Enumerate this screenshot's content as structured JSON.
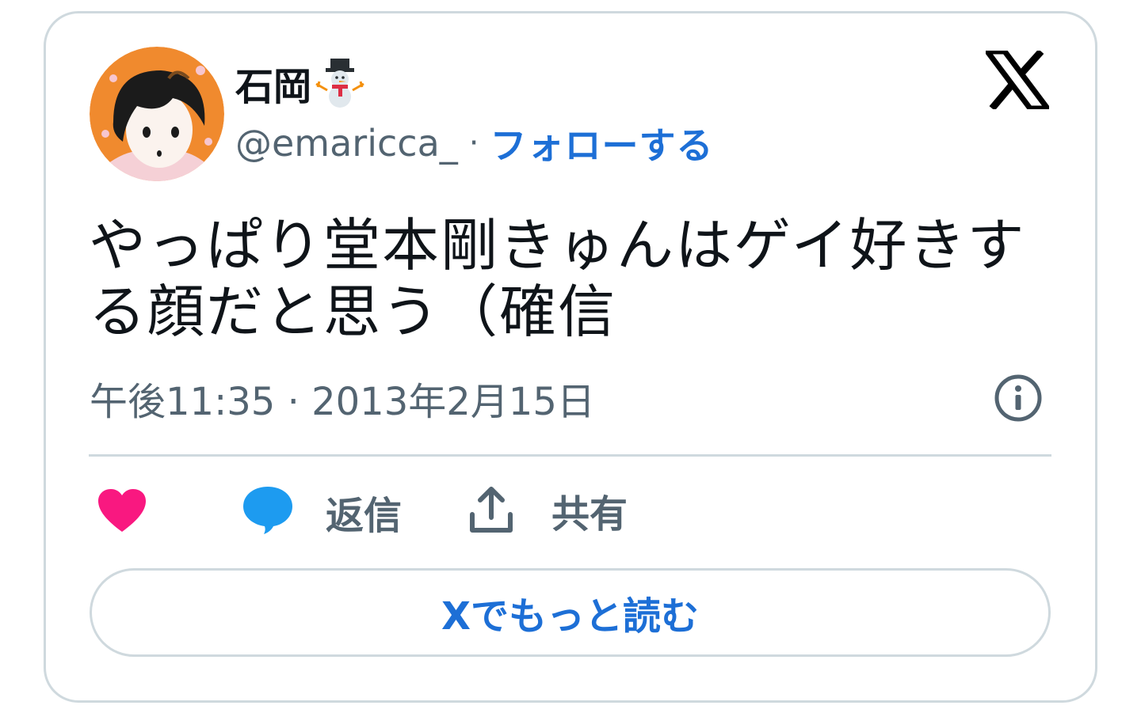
{
  "author": {
    "display_name": "石岡",
    "name_emoji_icon": "snowman-icon",
    "handle": "@emaricca_",
    "separator": "·",
    "follow_label": "フォローする"
  },
  "tweet": {
    "text": "やっぱり堂本剛きゅんはゲイ好きする顔だと思う（確信",
    "timestamp": "午後11:35 · 2013年2月15日"
  },
  "actions": {
    "like_icon": "heart-icon",
    "reply_icon": "speech-bubble-icon",
    "reply_label": "返信",
    "share_icon": "upload-icon",
    "share_label": "共有"
  },
  "read_more_label": "Xでもっと読む",
  "colors": {
    "accent": "#1d6fd6",
    "like": "#f91880",
    "reply_bubble": "#1d9bf0",
    "text_primary": "#0f1419",
    "text_secondary": "#536471",
    "border": "#cfd9de"
  }
}
